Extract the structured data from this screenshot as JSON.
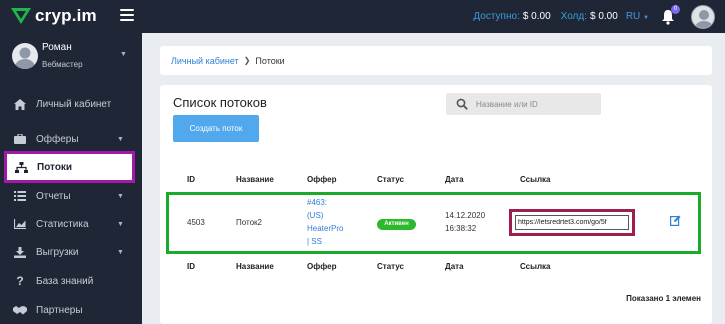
{
  "topbar": {
    "logo_text": "cryp.im",
    "balance_label": "Доступно:",
    "balance_value": "$ 0.00",
    "hold_label": "Холд:",
    "hold_value": "$ 0.00",
    "lang": "RU",
    "notifications_count": "0",
    "icons": [
      "logo-icon",
      "menu-icon",
      "chevron-down-icon",
      "bell-icon",
      "avatar"
    ]
  },
  "sidebar": {
    "user": {
      "name": "Роман",
      "role": "Вебмастер"
    },
    "items": [
      {
        "label": "Личный кабинет",
        "icon": "home-icon",
        "has_caret": false
      },
      {
        "label": "Офферы",
        "icon": "briefcase-icon",
        "has_caret": true
      },
      {
        "label": "Потоки",
        "icon": "sitemap-icon",
        "has_caret": false,
        "active": true
      },
      {
        "label": "Отчеты",
        "icon": "list-icon",
        "has_caret": true
      },
      {
        "label": "Статистика",
        "icon": "chart-icon",
        "has_caret": true
      },
      {
        "label": "Выгрузки",
        "icon": "download-icon",
        "has_caret": true
      },
      {
        "label": "База знаний",
        "icon": "question-icon",
        "has_caret": false
      },
      {
        "label": "Партнеры",
        "icon": "handshake-icon",
        "has_caret": false
      }
    ]
  },
  "breadcrumb": {
    "home": "Личный кабинет",
    "current": "Потоки"
  },
  "card": {
    "title": "Список потоков",
    "search_placeholder": "Название или ID",
    "create_button": "Создать поток",
    "columns": [
      "ID",
      "Название",
      "Оффер",
      "Статус",
      "Дата",
      "Ссылка"
    ],
    "rows": [
      {
        "id": "4503",
        "name": "Поток2",
        "offer_lines": [
          "#463:",
          "(US)",
          "HeaterPro",
          "| SS"
        ],
        "status": "Активен",
        "date_lines": [
          "14.12.2020",
          "16:38:32"
        ],
        "link": "https://letsredrtet3.com/go/5f"
      }
    ],
    "footer": "Показано 1 элемен"
  },
  "colors": {
    "sidebar_bg": "#1f2636",
    "accent_blue": "#52a8ec",
    "status_green": "#2eb82e",
    "highlight_row": "#1aab2b",
    "highlight_nav": "#a119a8",
    "highlight_link": "#a01d52"
  }
}
